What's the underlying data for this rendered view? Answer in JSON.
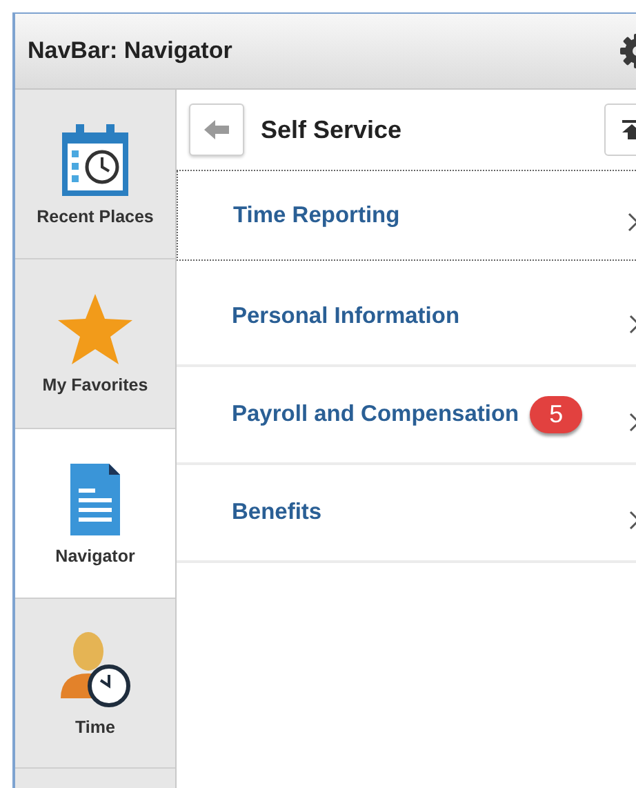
{
  "window": {
    "title": "NavBar: Navigator"
  },
  "sidebar": {
    "items": [
      {
        "label": "Recent Places",
        "kind": "calendar",
        "selected": false
      },
      {
        "label": "My Favorites",
        "kind": "star",
        "selected": false
      },
      {
        "label": "Navigator",
        "kind": "document",
        "selected": true
      },
      {
        "label": "Time",
        "kind": "person",
        "selected": false
      }
    ]
  },
  "content": {
    "title": "Self Service",
    "rows": [
      {
        "label": "Time Reporting",
        "focused": true
      },
      {
        "label": "Personal Information",
        "focused": false
      },
      {
        "label": "Payroll and Compensation",
        "focused": false,
        "badge": "5"
      },
      {
        "label": "Benefits",
        "focused": false
      }
    ]
  }
}
